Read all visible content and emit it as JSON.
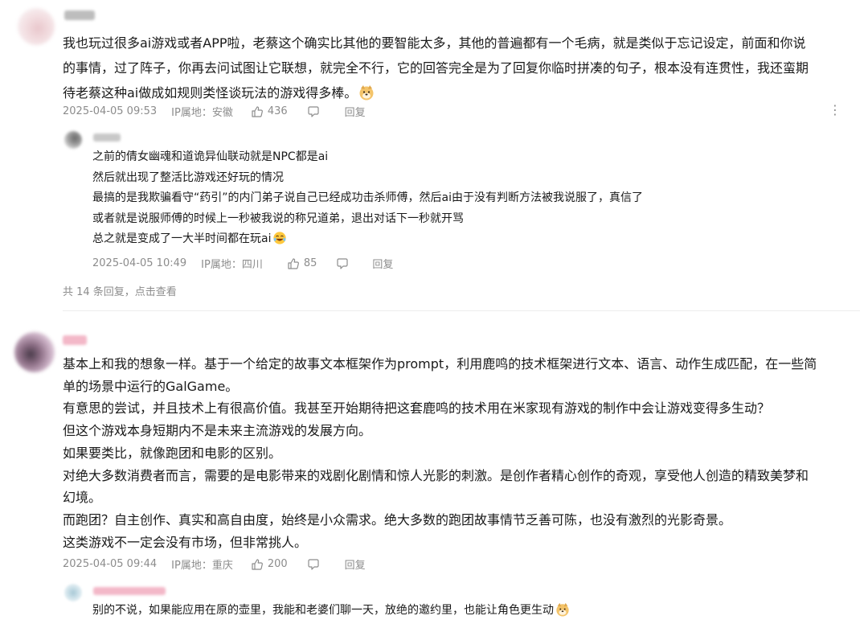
{
  "comments": [
    {
      "text_lines": [
        "我也玩过很多ai游戏或者APP啦，老蔡这个确实比其他的要智能太多，其他的普遍都有一个毛病，就是类似于忘记设定，前面和你说",
        "的事情，过了阵子，你再去问试图让它联想，就完全不行，它的回答完全是为了回复你临时拼凑的句子，根本没有连贯性，我还蛮期",
        "待老蔡这种ai做成如规则类怪谈玩法的游戏得多棒。"
      ],
      "date": "2025-04-05 09:53",
      "location": "IP属地：安徽",
      "likes": "436",
      "reply_label": "回复",
      "menu_glyph": "⋮",
      "replies": [
        {
          "text_lines": [
            "之前的倩女幽魂和道诡异仙联动就是NPC都是ai",
            "然后就出现了整活比游戏还好玩的情况",
            "最搞的是我欺骗看守“药引”的内门弟子说自己已经成功击杀师傅，然后ai由于没有判断方法被我说服了，真信了",
            "或者就是说服师傅的时候上一秒被我说的称兄道弟，退出对话下一秒就开骂",
            "总之就是变成了一大半时间都在玩ai"
          ],
          "date": "2025-04-05 10:49",
          "location": "IP属地：四川",
          "likes": "85",
          "reply_label": "回复"
        }
      ],
      "more_replies": "共 14 条回复，点击查看"
    },
    {
      "text_lines": [
        "基本上和我的想象一样。基于一个给定的故事文本框架作为prompt，利用鹿鸣的技术框架进行文本、语言、动作生成匹配，在一些简",
        "单的场景中运行的GalGame。",
        "有意思的尝试，并且技术上有很高价值。我甚至开始期待把这套鹿鸣的技术用在米家现有游戏的制作中会让游戏变得多生动？",
        "但这个游戏本身短期内不是未来主流游戏的发展方向。",
        "如果要类比，就像跑团和电影的区别。",
        "对绝大多数消费者而言，需要的是电影带来的戏剧化剧情和惊人光影的刺激。是创作者精心创作的奇观，享受他人创造的精致美梦和",
        "幻境。",
        "而跑团？自主创作、真实和高自由度，始终是小众需求。绝大多数的跑团故事情节乏善可陈，也没有激烈的光影奇景。",
        "这类游戏不一定会没有市场，但非常挑人。"
      ],
      "date": "2025-04-05 09:44",
      "location": "IP属地：重庆",
      "likes": "200",
      "reply_label": "回复",
      "replies": [
        {
          "text_lines": [
            "别的不说，如果能应用在原的壶里，我能和老婆们聊一天，放绝的邀约里，也能让角色更生动"
          ]
        }
      ]
    }
  ],
  "icons": [
    "like-icon",
    "comment-icon",
    "doge-emoji-icon",
    "laughing-emoji-icon"
  ],
  "colors": {
    "meta": "#8c8c8c",
    "text": "#1a1a1a",
    "divider": "#ececec"
  }
}
